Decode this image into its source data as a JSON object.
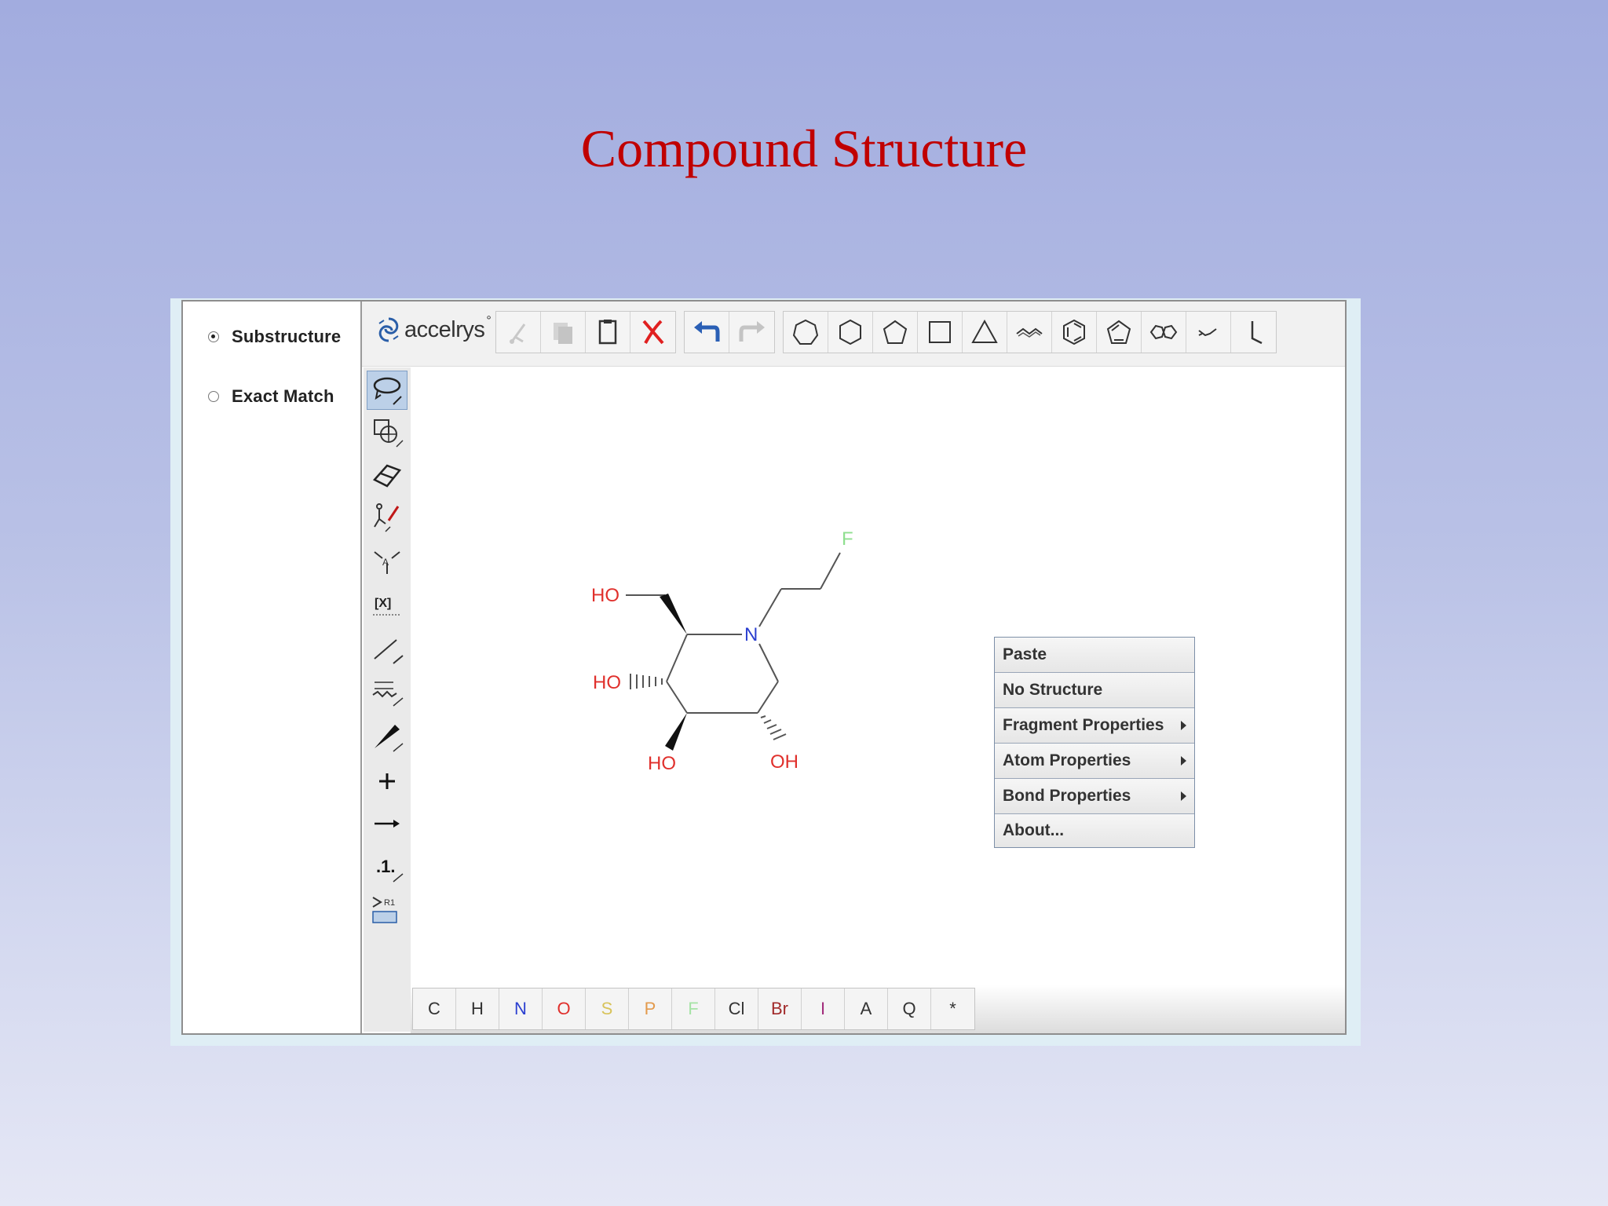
{
  "slide": {
    "title": "Compound Structure"
  },
  "search_mode": {
    "options": [
      {
        "label": "Substructure",
        "selected": true
      },
      {
        "label": "Exact Match",
        "selected": false
      }
    ]
  },
  "toolbar": {
    "logo_text": "accelrys",
    "logo_mark": "°",
    "edit_icons": [
      "cut-icon",
      "copy-icon",
      "paste-icon",
      "delete-icon"
    ],
    "history_icons": [
      "undo-icon",
      "redo-icon"
    ],
    "template_icons": [
      "heptagon-icon",
      "hexagon-icon",
      "pentagon-icon",
      "square-icon",
      "triangle-icon",
      "chain-icon",
      "benzene-icon",
      "cyclopentadiene-icon",
      "fused-rings-icon",
      "chair-icon",
      "bond-angle-icon"
    ]
  },
  "side_tools": [
    "lasso-select-icon",
    "rotate-icon",
    "eraser-icon",
    "atom-property-icon",
    "atom-map-icon",
    "bracket-icon",
    "single-bond-icon",
    "query-bond-icon",
    "wedge-bond-icon",
    "plus-icon",
    "reaction-arrow-icon",
    "atom-number-icon",
    "r-group-icon"
  ],
  "side_tool_texts": {
    "bracket": "[X]",
    "atom_number": ".1.",
    "r_group": "R1"
  },
  "molecule": {
    "atoms": {
      "F": "F",
      "N": "N",
      "HO1": "HO",
      "HO2": "HO",
      "HO3": "HO",
      "OH": "OH"
    },
    "colors": {
      "oxygen": "#e0302c",
      "nitrogen": "#2b3fd0",
      "fluorine": "#8fdf8f",
      "bond": "#555555"
    }
  },
  "context_menu": {
    "items": [
      {
        "label": "Paste",
        "submenu": false
      },
      {
        "label": "No Structure",
        "submenu": false
      },
      {
        "label": "Fragment Properties",
        "submenu": true
      },
      {
        "label": "Atom Properties",
        "submenu": true
      },
      {
        "label": "Bond Properties",
        "submenu": true
      },
      {
        "label": "About...",
        "submenu": false
      }
    ]
  },
  "atom_palette": [
    {
      "label": "C",
      "color": "#333333"
    },
    {
      "label": "H",
      "color": "#333333"
    },
    {
      "label": "N",
      "color": "#2b3fd0"
    },
    {
      "label": "O",
      "color": "#e0302c"
    },
    {
      "label": "S",
      "color": "#d8c35a"
    },
    {
      "label": "P",
      "color": "#e39a4c"
    },
    {
      "label": "F",
      "color": "#a6e3a6"
    },
    {
      "label": "Cl",
      "color": "#333333"
    },
    {
      "label": "Br",
      "color": "#a12a2a"
    },
    {
      "label": "I",
      "color": "#a12a7a"
    },
    {
      "label": "A",
      "color": "#333333"
    },
    {
      "label": "Q",
      "color": "#333333"
    },
    {
      "label": "*",
      "color": "#333333"
    }
  ]
}
